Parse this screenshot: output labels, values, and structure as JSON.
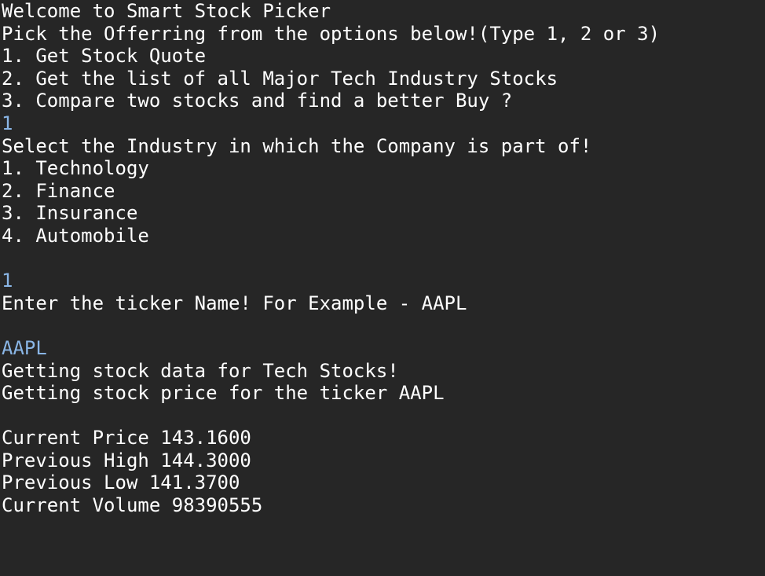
{
  "colors": {
    "background": "#262626",
    "output_text": "#ffffff",
    "user_input_text": "#8ab6e6"
  },
  "lines": [
    {
      "text": "Welcome to Smart Stock Picker",
      "kind": "output"
    },
    {
      "text": "Pick the Offerring from the options below!(Type 1, 2 or 3)",
      "kind": "output"
    },
    {
      "text": "1. Get Stock Quote",
      "kind": "output"
    },
    {
      "text": "2. Get the list of all Major Tech Industry Stocks",
      "kind": "output"
    },
    {
      "text": "3. Compare two stocks and find a better Buy ?",
      "kind": "output"
    },
    {
      "text": "1",
      "kind": "input"
    },
    {
      "text": "Select the Industry in which the Company is part of!",
      "kind": "output"
    },
    {
      "text": "1. Technology",
      "kind": "output"
    },
    {
      "text": "2. Finance",
      "kind": "output"
    },
    {
      "text": "3. Insurance",
      "kind": "output"
    },
    {
      "text": "4. Automobile",
      "kind": "output"
    },
    {
      "text": "",
      "kind": "blank"
    },
    {
      "text": "1",
      "kind": "input"
    },
    {
      "text": "Enter the ticker Name! For Example - AAPL",
      "kind": "output"
    },
    {
      "text": "",
      "kind": "blank"
    },
    {
      "text": "AAPL",
      "kind": "input"
    },
    {
      "text": "Getting stock data for Tech Stocks!",
      "kind": "output"
    },
    {
      "text": "Getting stock price for the ticker AAPL",
      "kind": "output"
    },
    {
      "text": "",
      "kind": "blank"
    },
    {
      "text": "Current Price 143.1600",
      "kind": "output"
    },
    {
      "text": "Previous High 144.3000",
      "kind": "output"
    },
    {
      "text": "Previous Low 141.3700",
      "kind": "output"
    },
    {
      "text": "Current Volume 98390555",
      "kind": "output"
    }
  ]
}
